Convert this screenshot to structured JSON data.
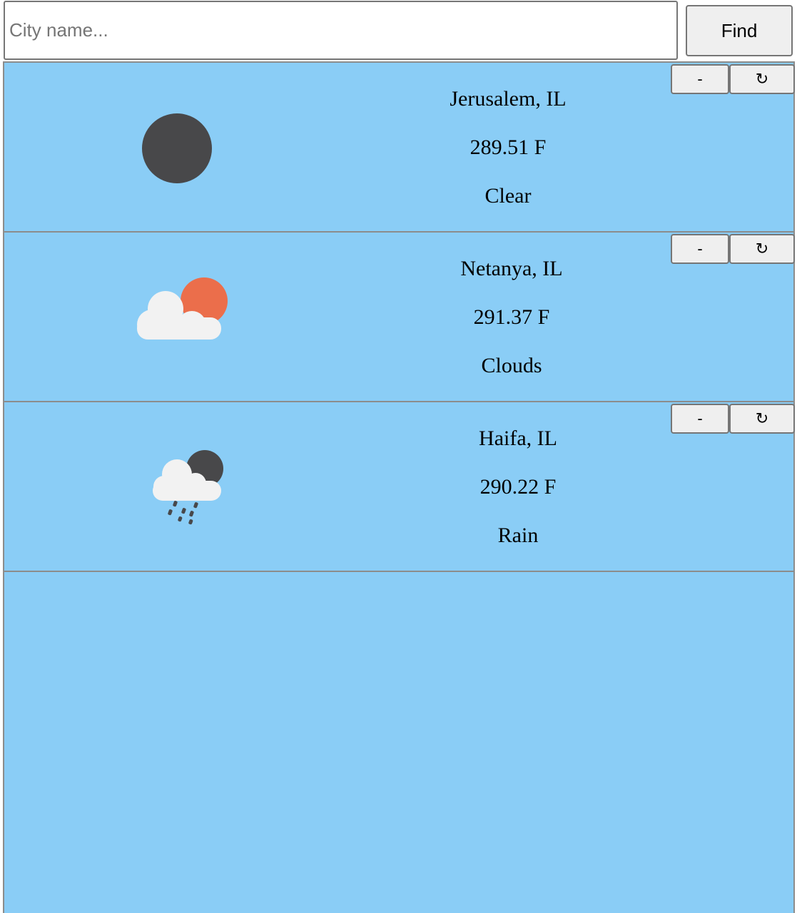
{
  "search": {
    "placeholder": "City name...",
    "value": "",
    "find_label": "Find"
  },
  "colors": {
    "panel_background": "#8acdf6",
    "sun_orange": "#eb6e4b",
    "moon_dark": "#48484a",
    "cloud_white": "#f2f2f2"
  },
  "cities": [
    {
      "name": "Jerusalem, IL",
      "temperature": "289.51 F",
      "condition": "Clear",
      "icon": "clear-night-icon",
      "remove_label": "-",
      "refresh_label": "↻"
    },
    {
      "name": "Netanya, IL",
      "temperature": "291.37 F",
      "condition": "Clouds",
      "icon": "cloudy-sun-icon",
      "remove_label": "-",
      "refresh_label": "↻"
    },
    {
      "name": "Haifa, IL",
      "temperature": "290.22 F",
      "condition": "Rain",
      "icon": "rain-night-icon",
      "remove_label": "-",
      "refresh_label": "↻"
    }
  ]
}
